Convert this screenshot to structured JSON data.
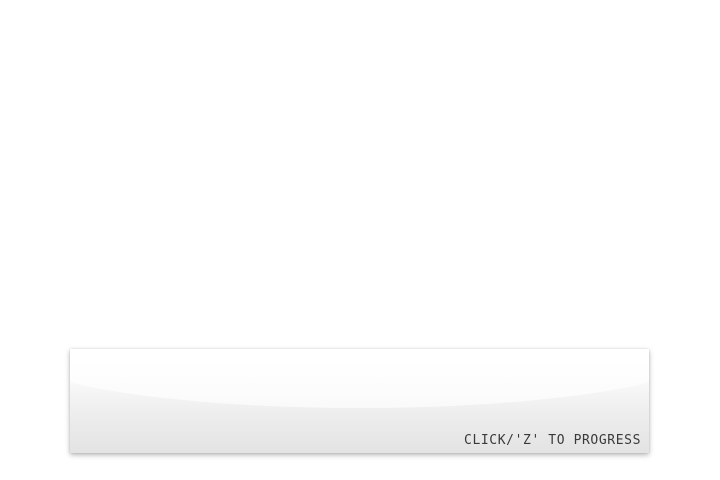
{
  "dialog": {
    "text": "",
    "prompt": "CLICK/'Z' TO PROGRESS",
    "accent_color": "#5eb0f8"
  }
}
